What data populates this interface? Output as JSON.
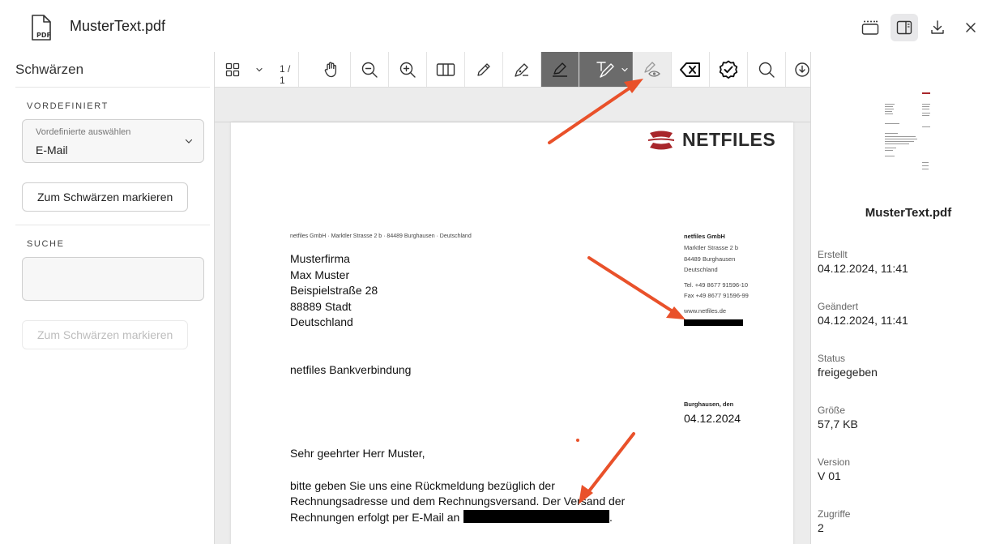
{
  "header": {
    "file_icon_label": "PDF",
    "title": "MusterText.pdf"
  },
  "left": {
    "title": "Schwärzen",
    "predefined_label": "VORDEFINIERT",
    "select_label": "Vordefinierte auswählen",
    "select_value": "E-Mail",
    "mark_button_1": "Zum Schwärzen markieren",
    "search_label": "SUCHE",
    "mark_button_2": "Zum Schwärzen markieren"
  },
  "toolbar": {
    "page_count": "1 / 1"
  },
  "document": {
    "logo": "NETFILES",
    "sender_line": "netfiles GmbH  ·  Marktler Strasse 2 b  ·  84489 Burghausen  ·  Deutschland",
    "address": [
      "Musterfirma",
      "Max Muster",
      "Beispielstraße 28",
      "88889 Stadt",
      "Deutschland"
    ],
    "company": {
      "name": "netfiles GmbH",
      "street": "Marktler Strasse 2 b",
      "city": "84489 Burghausen",
      "country": "Deutschland",
      "tel": "Tel. +49 8677 91596-10",
      "fax": "Fax +49 8677 91596-99",
      "web": "www.netfiles.de"
    },
    "subject": "netfiles Bankverbindung",
    "place_date_label": "Burghausen, den",
    "date": "04.12.2024",
    "salutation": "Sehr geehrter Herr Muster,",
    "body": [
      "bitte geben Sie uns eine Rückmeldung bezüglich der",
      "Rechnungsadresse und dem Rechnungsversand. Der Versand der",
      "Rechnungen erfolgt per E-Mail an"
    ],
    "body_end": "."
  },
  "right": {
    "filename": "MusterText.pdf",
    "meta": [
      {
        "label": "Erstellt",
        "value": "04.12.2024, 11:41"
      },
      {
        "label": "Geändert",
        "value": "04.12.2024, 11:41"
      },
      {
        "label": "Status",
        "value": "freigegeben"
      },
      {
        "label": "Größe",
        "value": "57,7 KB"
      },
      {
        "label": "Version",
        "value": "V 01"
      },
      {
        "label": "Zugriffe",
        "value": "2"
      }
    ]
  },
  "colors": {
    "accent_arrow": "#e9512a",
    "logo_red": "#a8262b",
    "redaction": "#000000"
  },
  "icons": [
    "pdf-file-icon",
    "panel-toggle-icon",
    "sidebar-icon",
    "download-icon",
    "close-icon",
    "grid-icon",
    "chevron-down-icon",
    "hand-icon",
    "zoom-out-icon",
    "zoom-in-icon",
    "columns-icon",
    "pencil-icon",
    "pen-icon",
    "highlighter-icon",
    "text-redact-icon",
    "eye-redact-icon",
    "delete-redaction-icon",
    "apply-redaction-icon",
    "search-icon",
    "download-circle-icon"
  ]
}
